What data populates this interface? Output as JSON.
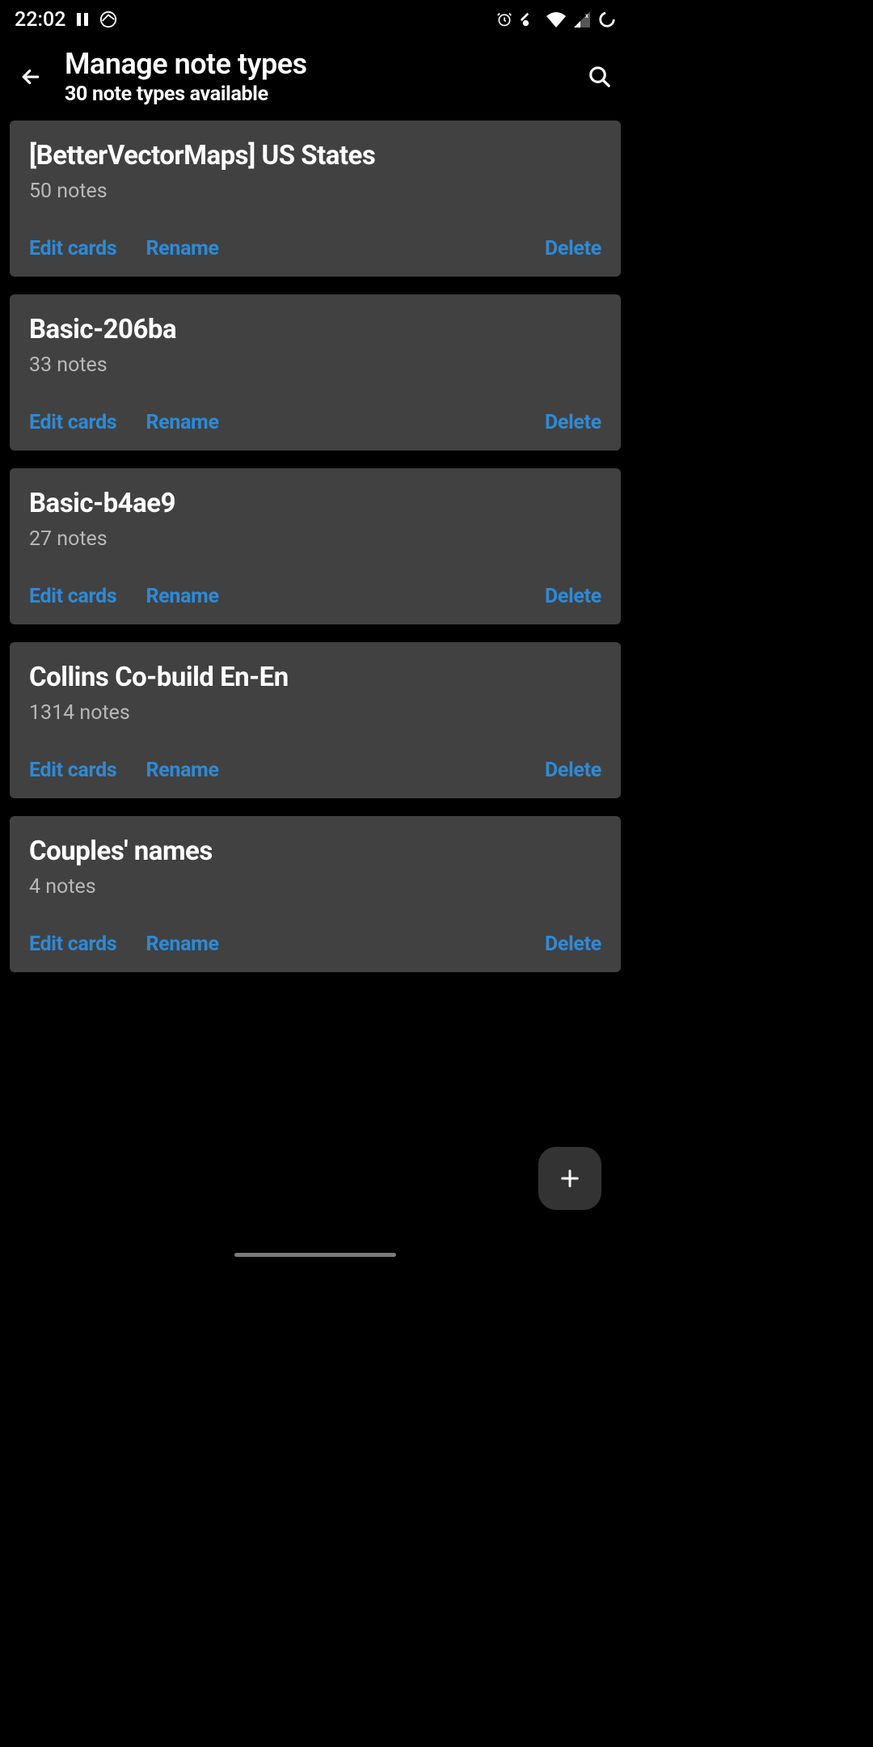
{
  "status": {
    "time": "22:02"
  },
  "header": {
    "title": "Manage note types",
    "subtitle": "30 note types available"
  },
  "actions": {
    "edit": "Edit cards",
    "rename": "Rename",
    "delete": "Delete"
  },
  "note_types": [
    {
      "name": "[BetterVectorMaps] US States",
      "count": "50 notes"
    },
    {
      "name": "Basic-206ba",
      "count": "33 notes"
    },
    {
      "name": "Basic-b4ae9",
      "count": "27 notes"
    },
    {
      "name": "Collins Co-build En-En",
      "count": "1314 notes"
    },
    {
      "name": "Couples' names",
      "count": "4 notes"
    }
  ]
}
